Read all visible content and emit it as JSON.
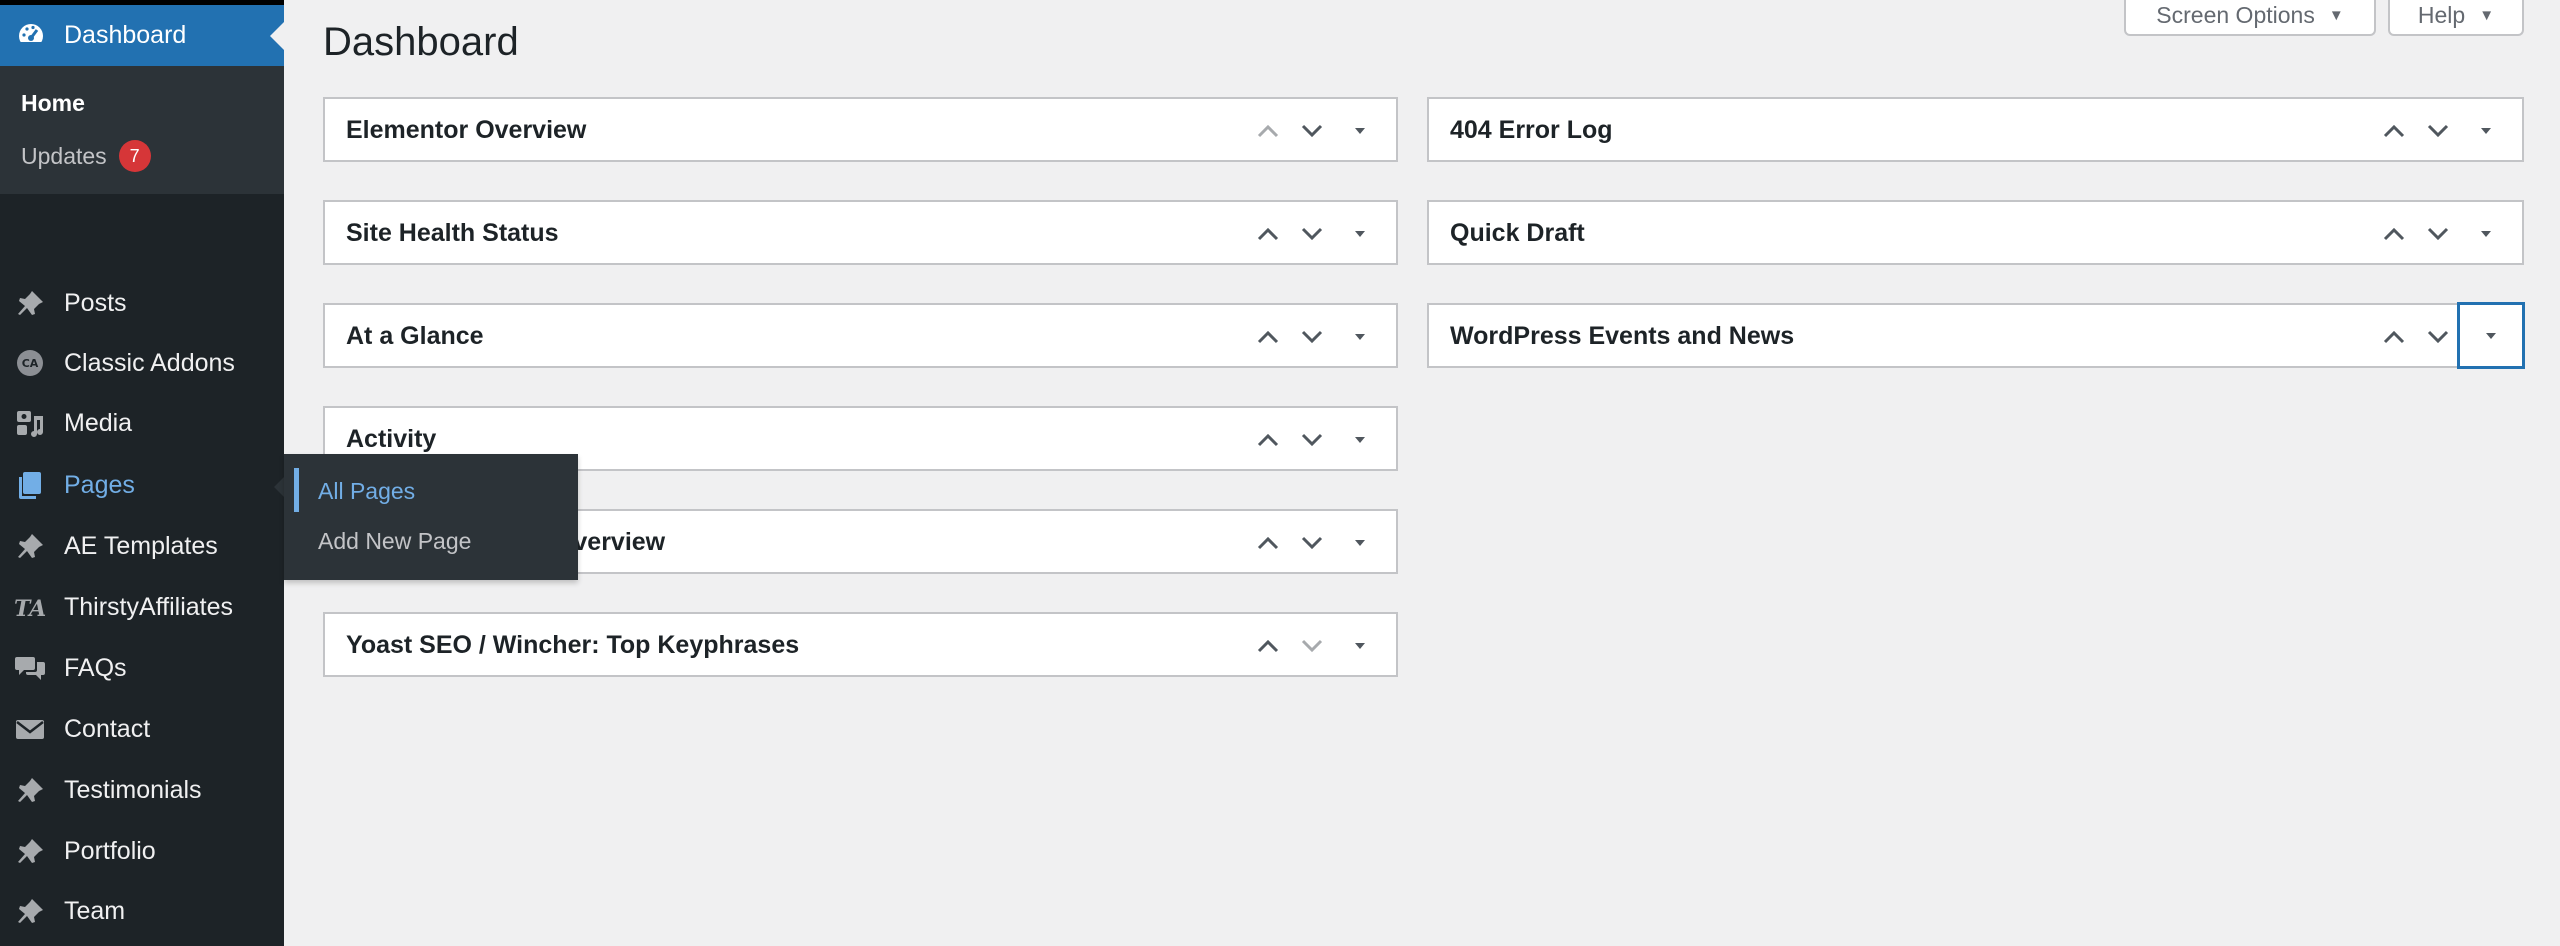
{
  "sidebar": {
    "dashboard_label": "Dashboard",
    "home_label": "Home",
    "updates_label": "Updates",
    "updates_count": "7",
    "items": [
      {
        "label": "Posts",
        "icon": "pushpin-icon"
      },
      {
        "label": "Classic Addons",
        "icon": "classic-addons-icon"
      },
      {
        "label": "Media",
        "icon": "media-icon"
      },
      {
        "label": "Pages",
        "icon": "pages-icon"
      },
      {
        "label": "AE Templates",
        "icon": "pushpin-icon"
      },
      {
        "label": "ThirstyAffiliates",
        "icon": "thirstyaffiliates-icon"
      },
      {
        "label": "FAQs",
        "icon": "comments-icon"
      },
      {
        "label": "Contact",
        "icon": "envelope-icon"
      },
      {
        "label": "Testimonials",
        "icon": "pushpin-icon"
      },
      {
        "label": "Portfolio",
        "icon": "pushpin-icon"
      },
      {
        "label": "Team",
        "icon": "pushpin-icon"
      }
    ],
    "pages_flyout": {
      "all_pages": "All Pages",
      "add_new": "Add New Page"
    }
  },
  "header": {
    "title": "Dashboard",
    "screen_options": "Screen Options",
    "help": "Help"
  },
  "widgets": {
    "left": [
      {
        "title": "Elementor Overview"
      },
      {
        "title": "Site Health Status"
      },
      {
        "title": "At a Glance"
      },
      {
        "title": "Activity"
      },
      {
        "title": "Yoast SEO Posts Overview"
      },
      {
        "title": "Yoast SEO / Wincher: Top Keyphrases"
      }
    ],
    "right": [
      {
        "title": "404 Error Log"
      },
      {
        "title": "Quick Draft"
      },
      {
        "title": "WordPress Events and News"
      }
    ]
  },
  "colors": {
    "sidebar_bg": "#1d2327",
    "submenu_bg": "#2c3338",
    "accent": "#2271b1",
    "highlight_text": "#72aee6",
    "badge": "#d63638",
    "page_bg": "#f0f0f1"
  }
}
